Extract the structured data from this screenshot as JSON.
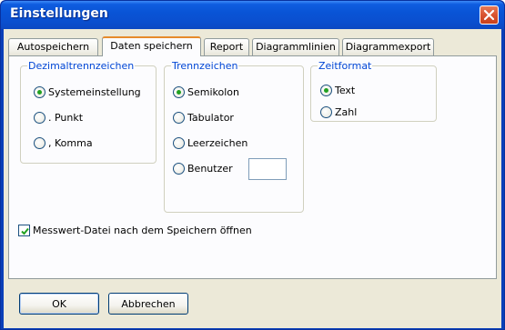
{
  "window": {
    "title": "Einstellungen"
  },
  "tabs": [
    {
      "label": "Autospeichern"
    },
    {
      "label": "Daten speichern",
      "active": true
    },
    {
      "label": "Report"
    },
    {
      "label": "Diagrammlinien"
    },
    {
      "label": "Diagrammexport"
    }
  ],
  "decimal_group": {
    "legend": "Dezimaltrennzeichen",
    "options": [
      {
        "label": "Systemeinstellung",
        "checked": true
      },
      {
        "label": ". Punkt",
        "checked": false
      },
      {
        "label": ", Komma",
        "checked": false
      }
    ]
  },
  "separator_group": {
    "legend": "Trennzeichen",
    "options": [
      {
        "label": "Semikolon",
        "checked": true
      },
      {
        "label": "Tabulator",
        "checked": false
      },
      {
        "label": "Leerzeichen",
        "checked": false
      },
      {
        "label": "Benutzer",
        "checked": false
      }
    ],
    "custom_value": ""
  },
  "time_group": {
    "legend": "Zeitformat",
    "options": [
      {
        "label": "Text",
        "checked": true
      },
      {
        "label": "Zahl",
        "checked": false
      }
    ]
  },
  "open_after_save": {
    "label": "Messwert-Datei nach dem Speichern öffnen",
    "checked": true
  },
  "buttons": {
    "ok": "OK",
    "cancel": "Abbrechen"
  },
  "colors": {
    "title_bar": "#0a4fcf",
    "dialog_bg": "#ece9d8",
    "legend_text": "#0046d5",
    "active_tab_accent": "#e68b2c",
    "close_button": "#d8532f"
  }
}
